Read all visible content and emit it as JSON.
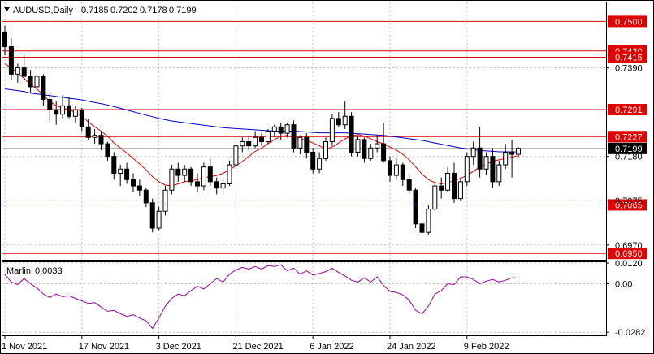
{
  "header": {
    "symbol": "AUDUSD,Daily",
    "open": "0.7185",
    "high": "0.7202",
    "low": "0.7178",
    "close": "0.7199"
  },
  "indicator": {
    "name": "Marlin",
    "value": "0.0033"
  },
  "colors": {
    "candle": "#000000",
    "ma_fast": "#e00000",
    "ma_slow": "#0000cc",
    "level": "#e00000",
    "osc": "#9b009b",
    "grid": "#c0c0c0"
  },
  "chart_data": [
    {
      "type": "candlestick",
      "title": "AUDUSD,Daily",
      "ylim": [
        0.6935,
        0.7545
      ],
      "y_ticks": [
        "0.7390",
        "0.7180",
        "0.7075",
        "0.6970"
      ],
      "x_labels": [
        "1 Nov 2021",
        "17 Nov 2021",
        "3 Dec 2021",
        "21 Dec 2021",
        "6 Jan 2022",
        "24 Jan 2022",
        "9 Feb 2022"
      ],
      "x_label_index": [
        0,
        12,
        24,
        36,
        48,
        60,
        72
      ],
      "levels": [
        "0.7500",
        "0.7430",
        "0.7415",
        "0.7291",
        "0.7227",
        "0.7065",
        "0.6950"
      ],
      "current_price": "0.7199",
      "candles": [
        [
          0.7475,
          0.749,
          0.742,
          0.744
        ],
        [
          0.744,
          0.746,
          0.736,
          0.7375
        ],
        [
          0.7375,
          0.74,
          0.7355,
          0.739
        ],
        [
          0.739,
          0.742,
          0.736,
          0.737
        ],
        [
          0.737,
          0.7385,
          0.733,
          0.7345
        ],
        [
          0.7345,
          0.739,
          0.733,
          0.737
        ],
        [
          0.737,
          0.7375,
          0.73,
          0.7315
        ],
        [
          0.7315,
          0.733,
          0.726,
          0.729
        ],
        [
          0.729,
          0.731,
          0.7255,
          0.728
        ],
        [
          0.728,
          0.7325,
          0.727,
          0.73
        ],
        [
          0.73,
          0.732,
          0.727,
          0.7275
        ],
        [
          0.7275,
          0.73,
          0.726,
          0.729
        ],
        [
          0.729,
          0.7295,
          0.724,
          0.725
        ],
        [
          0.725,
          0.727,
          0.722,
          0.7225
        ],
        [
          0.7225,
          0.7245,
          0.721,
          0.723
        ],
        [
          0.723,
          0.724,
          0.7195,
          0.721
        ],
        [
          0.721,
          0.7215,
          0.717,
          0.718
        ],
        [
          0.718,
          0.719,
          0.7125,
          0.714
        ],
        [
          0.714,
          0.716,
          0.711,
          0.715
        ],
        [
          0.715,
          0.7165,
          0.7115,
          0.7125
        ],
        [
          0.7125,
          0.714,
          0.7095,
          0.711
        ],
        [
          0.711,
          0.7125,
          0.7085,
          0.71
        ],
        [
          0.71,
          0.7105,
          0.706,
          0.707
        ],
        [
          0.707,
          0.708,
          0.7,
          0.701
        ],
        [
          0.701,
          0.706,
          0.7005,
          0.705
        ],
        [
          0.705,
          0.711,
          0.704,
          0.71
        ],
        [
          0.71,
          0.716,
          0.709,
          0.715
        ],
        [
          0.715,
          0.7165,
          0.712,
          0.7135
        ],
        [
          0.7135,
          0.716,
          0.712,
          0.715
        ],
        [
          0.715,
          0.7155,
          0.711,
          0.712
        ],
        [
          0.712,
          0.714,
          0.7095,
          0.711
        ],
        [
          0.711,
          0.7165,
          0.71,
          0.7155
        ],
        [
          0.7155,
          0.7175,
          0.711,
          0.712
        ],
        [
          0.712,
          0.713,
          0.709,
          0.7105
        ],
        [
          0.7105,
          0.713,
          0.709,
          0.7115
        ],
        [
          0.7115,
          0.717,
          0.711,
          0.716
        ],
        [
          0.716,
          0.7215,
          0.715,
          0.7205
        ],
        [
          0.7205,
          0.7225,
          0.719,
          0.7215
        ],
        [
          0.7215,
          0.723,
          0.7195,
          0.7205
        ],
        [
          0.7205,
          0.724,
          0.72,
          0.7225
        ],
        [
          0.7225,
          0.7235,
          0.7205,
          0.7215
        ],
        [
          0.7215,
          0.7245,
          0.721,
          0.724
        ],
        [
          0.724,
          0.7255,
          0.7225,
          0.725
        ],
        [
          0.725,
          0.726,
          0.722,
          0.7235
        ],
        [
          0.7235,
          0.726,
          0.7225,
          0.7255
        ],
        [
          0.7255,
          0.7265,
          0.719,
          0.72
        ],
        [
          0.72,
          0.723,
          0.7185,
          0.7225
        ],
        [
          0.7225,
          0.7235,
          0.7175,
          0.719
        ],
        [
          0.719,
          0.72,
          0.714,
          0.715
        ],
        [
          0.715,
          0.719,
          0.714,
          0.7175
        ],
        [
          0.7175,
          0.7225,
          0.717,
          0.7215
        ],
        [
          0.7215,
          0.728,
          0.7205,
          0.727
        ],
        [
          0.727,
          0.7285,
          0.725,
          0.7255
        ],
        [
          0.7255,
          0.731,
          0.7245,
          0.7275
        ],
        [
          0.7275,
          0.7285,
          0.718,
          0.719
        ],
        [
          0.719,
          0.723,
          0.718,
          0.722
        ],
        [
          0.722,
          0.7225,
          0.7165,
          0.7175
        ],
        [
          0.7175,
          0.721,
          0.717,
          0.72
        ],
        [
          0.72,
          0.723,
          0.719,
          0.721
        ],
        [
          0.721,
          0.726,
          0.7165,
          0.717
        ],
        [
          0.717,
          0.718,
          0.712,
          0.7135
        ],
        [
          0.7135,
          0.7175,
          0.7125,
          0.716
        ],
        [
          0.716,
          0.7165,
          0.711,
          0.7125
        ],
        [
          0.7125,
          0.714,
          0.709,
          0.71
        ],
        [
          0.71,
          0.7105,
          0.701,
          0.702
        ],
        [
          0.702,
          0.704,
          0.6985,
          0.7
        ],
        [
          0.7,
          0.7065,
          0.6995,
          0.7055
        ],
        [
          0.7055,
          0.712,
          0.705,
          0.711
        ],
        [
          0.711,
          0.713,
          0.708,
          0.71
        ],
        [
          0.71,
          0.7155,
          0.7095,
          0.714
        ],
        [
          0.714,
          0.7165,
          0.707,
          0.708
        ],
        [
          0.708,
          0.713,
          0.7075,
          0.712
        ],
        [
          0.712,
          0.719,
          0.711,
          0.718
        ],
        [
          0.718,
          0.7215,
          0.716,
          0.72
        ],
        [
          0.72,
          0.725,
          0.713,
          0.715
        ],
        [
          0.715,
          0.719,
          0.7135,
          0.718
        ],
        [
          0.718,
          0.72,
          0.7105,
          0.712
        ],
        [
          0.712,
          0.717,
          0.711,
          0.716
        ],
        [
          0.716,
          0.721,
          0.715,
          0.719
        ],
        [
          0.719,
          0.722,
          0.713,
          0.7185
        ],
        [
          0.7185,
          0.7202,
          0.7178,
          0.7199
        ]
      ],
      "ma_fast": [
        0.74,
        0.739,
        0.7378,
        0.7365,
        0.735,
        0.734,
        0.7325,
        0.731,
        0.73,
        0.7295,
        0.729,
        0.7285,
        0.7275,
        0.7262,
        0.725,
        0.724,
        0.7228,
        0.7212,
        0.72,
        0.7188,
        0.7175,
        0.7162,
        0.7148,
        0.7132,
        0.712,
        0.7112,
        0.711,
        0.7115,
        0.712,
        0.7122,
        0.7125,
        0.713,
        0.7132,
        0.7135,
        0.714,
        0.7148,
        0.7158,
        0.7168,
        0.718,
        0.7192,
        0.72,
        0.721,
        0.722,
        0.7228,
        0.723,
        0.7225,
        0.7222,
        0.7218,
        0.7212,
        0.7205,
        0.7198,
        0.7202,
        0.7212,
        0.7222,
        0.7228,
        0.7232,
        0.7228,
        0.7222,
        0.7215,
        0.721,
        0.7202,
        0.7195,
        0.7185,
        0.7172,
        0.7155,
        0.7138,
        0.7125,
        0.7118,
        0.7115,
        0.7118,
        0.7122,
        0.7128,
        0.7135,
        0.7145,
        0.7155,
        0.7162,
        0.7168,
        0.7172,
        0.7175,
        0.7178,
        0.7182
      ],
      "ma_slow": [
        0.734,
        0.7338,
        0.7336,
        0.7334,
        0.733,
        0.7328,
        0.7326,
        0.7324,
        0.7322,
        0.732,
        0.7318,
        0.7316,
        0.7314,
        0.7311,
        0.7308,
        0.7305,
        0.7302,
        0.7298,
        0.7294,
        0.729,
        0.7286,
        0.7282,
        0.7278,
        0.7274,
        0.727,
        0.7267,
        0.7264,
        0.7262,
        0.726,
        0.7258,
        0.7256,
        0.7254,
        0.7252,
        0.725,
        0.7248,
        0.7247,
        0.7246,
        0.7245,
        0.7244,
        0.7243,
        0.7242,
        0.7241,
        0.724,
        0.724,
        0.724,
        0.724,
        0.7239,
        0.7238,
        0.7237,
        0.7236,
        0.7236,
        0.7236,
        0.7236,
        0.7236,
        0.7235,
        0.7234,
        0.7233,
        0.7232,
        0.7231,
        0.723,
        0.7228,
        0.7226,
        0.7224,
        0.7222,
        0.722,
        0.7218,
        0.7215,
        0.7212,
        0.7209,
        0.7206,
        0.7203,
        0.72,
        0.7198,
        0.7196,
        0.7194,
        0.7193,
        0.7192,
        0.7191,
        0.7191,
        0.7191,
        0.7191
      ]
    },
    {
      "type": "line",
      "title": "Marlin 0.0033",
      "ylim": [
        -0.03,
        0.0125
      ],
      "y_ticks": [
        "0.0120",
        "0.00",
        "-0.0282"
      ],
      "series": [
        {
          "name": "Marlin",
          "values": [
            0.0055,
            0.001,
            -0.0005,
            0.003,
            0.0,
            -0.0025,
            -0.006,
            -0.008,
            -0.006,
            -0.0075,
            -0.007,
            -0.0085,
            -0.01,
            -0.0115,
            -0.011,
            -0.0135,
            -0.016,
            -0.0155,
            -0.0175,
            -0.019,
            -0.018,
            -0.02,
            -0.0215,
            -0.026,
            -0.02,
            -0.013,
            -0.0085,
            -0.006,
            -0.007,
            -0.004,
            -0.0015,
            -0.003,
            0.0,
            0.003,
            0.001,
            0.0055,
            0.008,
            0.0095,
            0.0085,
            0.01,
            0.0085,
            0.0105,
            0.01,
            0.011,
            0.0075,
            0.009,
            0.0055,
            0.0075,
            0.005,
            0.006,
            0.007,
            0.009,
            0.0065,
            0.0045,
            0.002,
            0.001,
            0.0035,
            0.001,
            0.004,
            -0.001,
            -0.0045,
            -0.005,
            -0.0065,
            -0.0095,
            -0.0155,
            -0.0175,
            -0.013,
            -0.006,
            -0.004,
            0.0,
            -0.0005,
            0.004,
            0.004,
            0.0025,
            0.0,
            0.0015,
            0.0025,
            0.001,
            0.002,
            0.0035,
            0.0033
          ]
        }
      ]
    }
  ]
}
